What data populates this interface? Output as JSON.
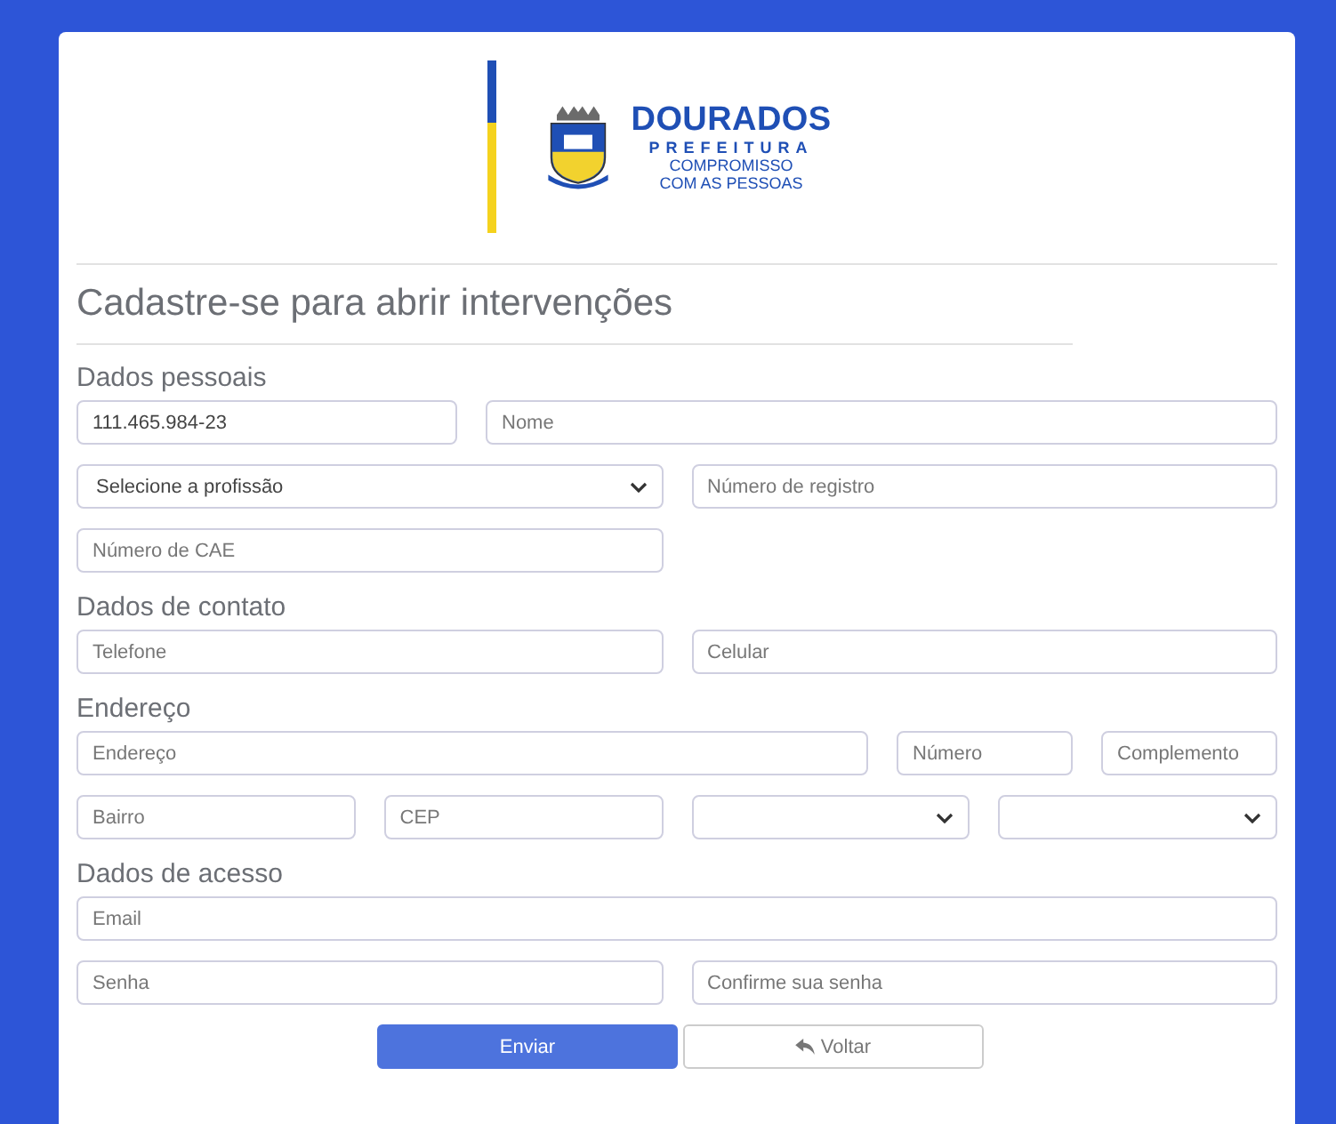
{
  "logo": {
    "name": "DOURADOS",
    "subtitle": "PREFEITURA",
    "slogan_lines": [
      "COMPROMISSO",
      "COM AS PESSOAS"
    ]
  },
  "title": "Cadastre-se para abrir intervenções",
  "sections": [
    {
      "title": "Dados pessoais",
      "rows": [
        [
          {
            "kind": "input",
            "value": "111.465.984-23"
          },
          {
            "kind": "input",
            "placeholder": "Nome"
          }
        ],
        [
          {
            "kind": "select",
            "value": "Selecione a profissão"
          },
          {
            "kind": "input",
            "placeholder": "Número de registro"
          }
        ],
        [
          {
            "kind": "input",
            "placeholder": "Número de CAE"
          }
        ]
      ]
    },
    {
      "title": "Dados de contato",
      "rows": [
        [
          {
            "kind": "input",
            "placeholder": "Telefone"
          },
          {
            "kind": "input",
            "placeholder": "Celular"
          }
        ]
      ]
    },
    {
      "title": "Endereço",
      "rows": [
        [
          {
            "kind": "input",
            "placeholder": "Endereço"
          },
          {
            "kind": "input",
            "placeholder": "Número"
          },
          {
            "kind": "input",
            "placeholder": "Complemento"
          }
        ],
        [
          {
            "kind": "input",
            "placeholder": "Bairro"
          },
          {
            "kind": "input",
            "placeholder": "CEP"
          },
          {
            "kind": "select"
          },
          {
            "kind": "select"
          }
        ]
      ]
    },
    {
      "title": "Dados de acesso",
      "rows": [
        [
          {
            "kind": "input",
            "placeholder": "Email"
          }
        ],
        [
          {
            "kind": "input",
            "placeholder": "Senha"
          },
          {
            "kind": "input",
            "placeholder": "Confirme sua senha"
          }
        ]
      ]
    }
  ],
  "buttons": [
    {
      "label": "Enviar",
      "kind": "primary"
    },
    {
      "label": "Voltar",
      "kind": "back"
    }
  ]
}
